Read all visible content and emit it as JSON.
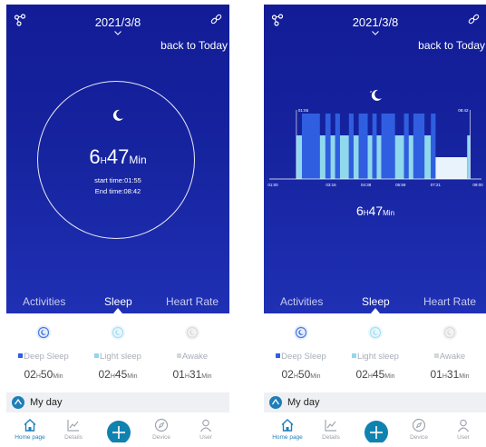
{
  "date": "2021/3/8",
  "back_to_today": "back to Today",
  "tabs": [
    "Activities",
    "Sleep",
    "Heart Rate"
  ],
  "sleep_summary": {
    "hours": "6",
    "hours_unit": "H",
    "minutes": "47",
    "minutes_unit": "Min",
    "start_label": "start time:01:55",
    "end_label": "End time:08:42"
  },
  "stats": [
    {
      "label": "Deep Sleep",
      "color": "#2f5fe0",
      "h": "02",
      "m": "50"
    },
    {
      "label": "Light sleep",
      "color": "#8fd8ee",
      "h": "02",
      "m": "45"
    },
    {
      "label": "Awake",
      "color": "#d6d6d6",
      "h": "01",
      "m": "31"
    }
  ],
  "stat_units": {
    "h": "H",
    "m": "Min"
  },
  "my_day": "My day",
  "nav": {
    "home": "Home page",
    "details": "Details",
    "device": "Device",
    "user": "User"
  },
  "chart_data": {
    "type": "bar",
    "x_ticks": [
      "01:00",
      "03:16",
      "04:38",
      "05:59",
      "07:21",
      "09:00"
    ],
    "start_marker": "01:55",
    "end_marker": "08:42",
    "levels": {
      "deep": 3,
      "light": 2,
      "awake": 1
    },
    "segments": [
      {
        "stage": "light",
        "start": "01:55",
        "end": "02:08"
      },
      {
        "stage": "deep",
        "start": "02:08",
        "end": "02:50"
      },
      {
        "stage": "light",
        "start": "02:50",
        "end": "03:03"
      },
      {
        "stage": "deep",
        "start": "03:03",
        "end": "03:15"
      },
      {
        "stage": "light",
        "start": "03:15",
        "end": "03:26"
      },
      {
        "stage": "deep",
        "start": "03:26",
        "end": "03:37"
      },
      {
        "stage": "light",
        "start": "03:37",
        "end": "03:58"
      },
      {
        "stage": "deep",
        "start": "03:58",
        "end": "04:09"
      },
      {
        "stage": "light",
        "start": "04:09",
        "end": "04:21"
      },
      {
        "stage": "deep",
        "start": "04:21",
        "end": "04:42"
      },
      {
        "stage": "light",
        "start": "04:42",
        "end": "04:53"
      },
      {
        "stage": "deep",
        "start": "04:53",
        "end": "05:03"
      },
      {
        "stage": "light",
        "start": "05:03",
        "end": "05:14"
      },
      {
        "stage": "deep",
        "start": "05:14",
        "end": "05:46"
      },
      {
        "stage": "light",
        "start": "05:46",
        "end": "06:07"
      },
      {
        "stage": "deep",
        "start": "06:07",
        "end": "06:18"
      },
      {
        "stage": "light",
        "start": "06:18",
        "end": "06:29"
      },
      {
        "stage": "deep",
        "start": "06:29",
        "end": "06:55"
      },
      {
        "stage": "light",
        "start": "06:55",
        "end": "07:10"
      },
      {
        "stage": "deep",
        "start": "07:10",
        "end": "07:21"
      },
      {
        "stage": "awake",
        "start": "07:21",
        "end": "08:35"
      },
      {
        "stage": "light",
        "start": "08:35",
        "end": "08:42"
      }
    ]
  },
  "colors": {
    "hero": "#16239e",
    "deep": "#2f5fe0",
    "light": "#8fd8ee",
    "awake": "#e9f3fb",
    "accent": "#0f82b0"
  }
}
